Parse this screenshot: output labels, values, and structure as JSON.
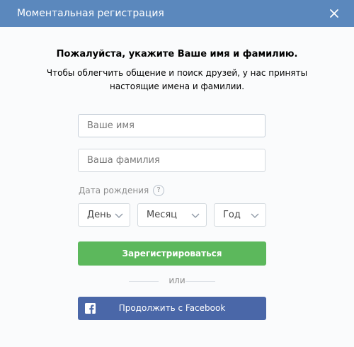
{
  "header": {
    "title": "Моментальная регистрация",
    "close_icon": "close-icon"
  },
  "main": {
    "heading": "Пожалуйста, укажите Ваше имя и фамилию.",
    "subheading": "Чтобы облегчить общение и поиск друзей, у нас приняты настоящие имена и фамилии.",
    "first_name": {
      "value": "",
      "placeholder": "Ваше имя"
    },
    "last_name": {
      "value": "",
      "placeholder": "Ваша фамилия"
    },
    "dob_label": "Дата рождения",
    "dob_help": "?",
    "day_select": "День",
    "month_select": "Месяц",
    "year_select": "Год",
    "register_button": "Зарегистрироваться",
    "or_text": "или",
    "facebook_button": "Продолжить с Facebook",
    "facebook_icon": "facebook-icon"
  },
  "colors": {
    "header_bg": "#5b88bd",
    "register_button_bg": "#5cb85c",
    "facebook_button_bg": "#4a67a8"
  }
}
